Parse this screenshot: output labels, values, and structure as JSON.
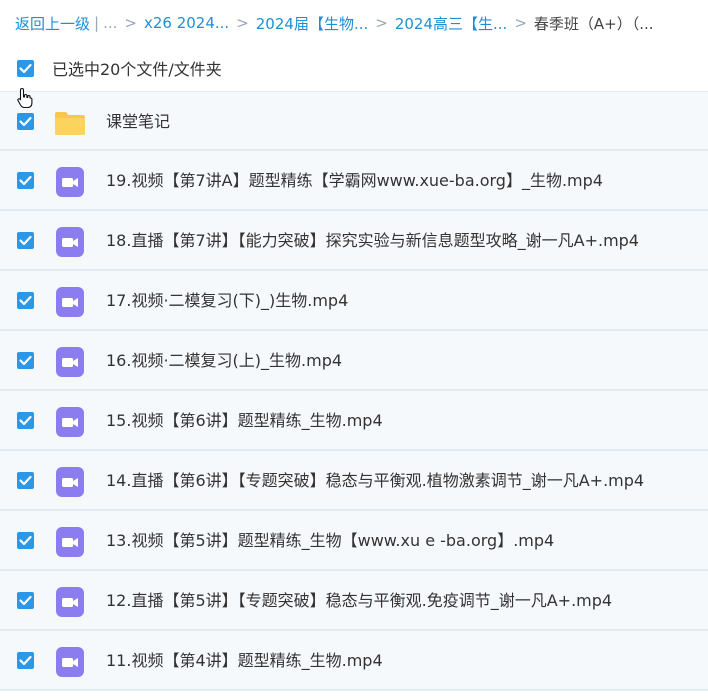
{
  "breadcrumb": {
    "back": "返回上一级",
    "divider": "|",
    "ellipsis": "...",
    "sep": ">",
    "items": [
      "x26 2024...",
      "2024届【生物...",
      "2024高三【生...",
      "春季班（A+）（..."
    ]
  },
  "selection": {
    "text": "已选中20个文件/文件夹"
  },
  "files": [
    {
      "name": "课堂笔记",
      "type": "folder"
    },
    {
      "name": "19.视频【第7讲A】题型精练【学霸网www.xue-ba.org】_生物.mp4",
      "type": "video"
    },
    {
      "name": "18.直播【第7讲】【能力突破】探究实验与新信息题型攻略_谢一凡A+.mp4",
      "type": "video"
    },
    {
      "name": "17.视频·二模复习(下)_)生物.mp4",
      "type": "video"
    },
    {
      "name": "16.视频·二模复习(上)_生物.mp4",
      "type": "video"
    },
    {
      "name": "15.视频【第6讲】题型精练_生物.mp4",
      "type": "video"
    },
    {
      "name": "14.直播【第6讲】【专题突破】稳态与平衡观.植物激素调节_谢一凡A+.mp4",
      "type": "video"
    },
    {
      "name": "13.视频【第5讲】题型精练_生物【www.xu e -ba.org】.mp4",
      "type": "video"
    },
    {
      "name": "12.直播【第5讲】【专题突破】稳态与平衡观.免疫调节_谢一凡A+.mp4",
      "type": "video"
    },
    {
      "name": "11.视频【第4讲】题型精练_生物.mp4",
      "type": "video"
    }
  ],
  "icons": {
    "checkbox": "checkbox-checked-icon",
    "folder": "folder-icon",
    "video": "video-file-icon",
    "cursor": "hand-pointer-icon"
  },
  "colors": {
    "link": "#1f8fd4",
    "checkbox": "#2b97e6",
    "folder": "#f8c84a",
    "video": "#8b7cf0",
    "row_bg": "#f6f9fc",
    "row_border": "#e3ecf4"
  }
}
